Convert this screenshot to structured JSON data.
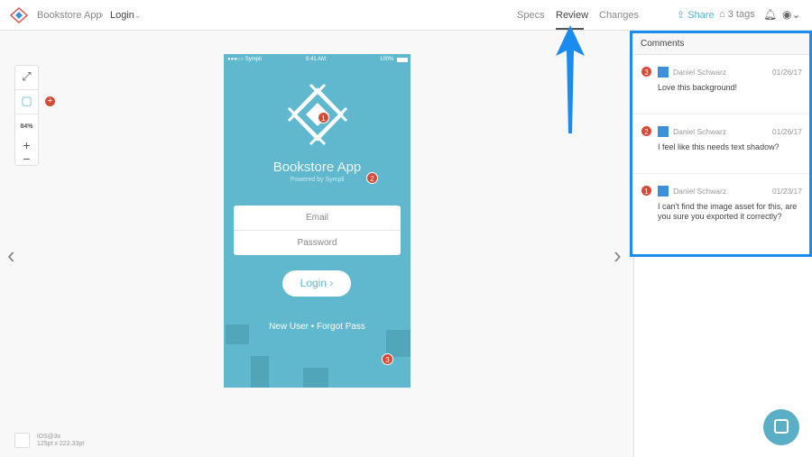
{
  "header": {
    "project": "Bookstore App",
    "screen": "Login",
    "tabs": [
      "Specs",
      "Review",
      "Changes"
    ],
    "active_tab": "Review",
    "share": "Share",
    "tags": "3 tags"
  },
  "toolbox": {
    "zoom": "84%",
    "plus": "+",
    "minus": "−"
  },
  "phone": {
    "carrier": "●●●○○ Sympli",
    "time": "9:41 AM",
    "battery": "100%",
    "title": "Bookstore App",
    "subtitle": "Powered by Sympli",
    "email_placeholder": "Email",
    "password_placeholder": "Password",
    "login": "Login",
    "footer": "New User • Forgot Pass",
    "pins": [
      "1",
      "2",
      "3"
    ]
  },
  "comments": {
    "title": "Comments",
    "items": [
      {
        "num": "3",
        "author": "Daniel Schwarz",
        "date": "01/26/17",
        "text": "Love this background!"
      },
      {
        "num": "2",
        "author": "Daniel Schwarz",
        "date": "01/26/17",
        "text": "I feel like this needs text shadow?"
      },
      {
        "num": "1",
        "author": "Daniel Schwarz",
        "date": "01/23/17",
        "text": "I can't find the image asset for this, are you sure you exported it correctly?"
      }
    ]
  },
  "footer_info": {
    "platform": "iOS@3x",
    "size": "125pt x 222.33pt"
  },
  "colors": {
    "accent": "#1a8cf0",
    "phone_bg": "#5fb8cd",
    "pin": "#d64a35"
  }
}
